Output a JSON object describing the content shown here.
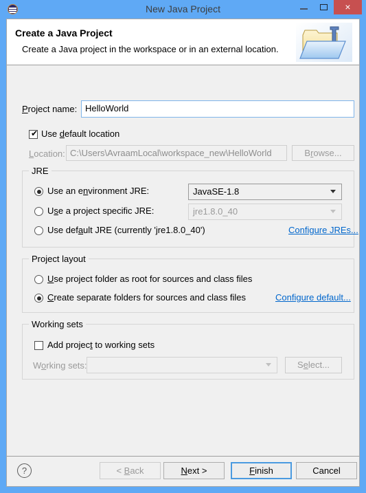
{
  "window": {
    "title": "New Java Project",
    "icon": "eclipse-icon",
    "controls": {
      "minimize": "minimize-icon",
      "maximize": "maximize-icon",
      "close": "×"
    },
    "accent_color": "#5fa9f5",
    "close_color": "#c75050"
  },
  "header": {
    "title": "Create a Java Project",
    "subtitle": "Create a Java project in the workspace or in an external location.",
    "icon": "java-project-folder-icon"
  },
  "form": {
    "project_name": {
      "label_pre": "P",
      "label_post": "roject name:",
      "value": "HelloWorld"
    },
    "use_default_location": {
      "label_a": "Use ",
      "label_u": "d",
      "label_b": "efault location",
      "checked": true,
      "check_glyph": "✔"
    },
    "location": {
      "label_pre": "L",
      "label_post": "ocation:",
      "value": "C:\\Users\\AvraamLocal\\workspace_new\\HelloWorld",
      "enabled": false
    },
    "browse_button": {
      "pre": "B",
      "under": "r",
      "post": "owse...",
      "enabled": false
    }
  },
  "jre_group": {
    "title": "JRE",
    "option_execution_env": {
      "a": "Use an e",
      "u": "n",
      "b": "vironment JRE:",
      "mid": "viro",
      "selected": true,
      "full": "Use an environment JRE:"
    },
    "labels": {
      "exec_env_1": "Use an e",
      "exec_env_u": "n",
      "exec_env_2": "vironment JRE:"
    },
    "execution_env_value": "JavaSE-1.8",
    "option_project_specific": {
      "a": "U",
      "u": "s",
      "b": "e a project specific JRE:",
      "selected": false
    },
    "project_specific_value": "jre1.8.0_40",
    "option_default_jre": {
      "a": "Use def",
      "u": "a",
      "b": "ult JRE (currently 'jre1.8.0_40')",
      "selected": false
    },
    "configure_link": "Configure JREs..."
  },
  "layout_group": {
    "title": "Project layout",
    "option_root": {
      "u": "U",
      "b": "se project folder as root for sources and class files",
      "selected": false
    },
    "option_separate": {
      "u": "C",
      "b": "reate separate folders for sources and class files",
      "selected": true
    },
    "configure_link": "Configure default..."
  },
  "working_sets_group": {
    "title": "Working sets",
    "add_checkbox": {
      "a": "Add projec",
      "u": "t",
      "b": " to working sets",
      "checked": false
    },
    "label": {
      "a": "W",
      "u": "o",
      "b": "rking sets:"
    },
    "value": "",
    "select_button": {
      "a": "S",
      "u": "e",
      "b": "lect...",
      "enabled": false
    }
  },
  "footer": {
    "help": "?",
    "back": {
      "pre": "< ",
      "u": "B",
      "post": "ack",
      "enabled": false
    },
    "next": {
      "u": "N",
      "post": "ext >",
      "enabled": true
    },
    "finish": {
      "u": "F",
      "post": "inish",
      "enabled": true,
      "is_default": true
    },
    "cancel": {
      "label": "Cancel",
      "enabled": true
    }
  }
}
